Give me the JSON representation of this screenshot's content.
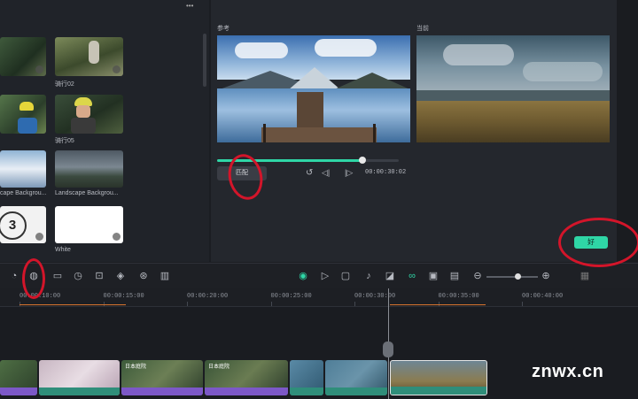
{
  "library": {
    "more_label": "•••",
    "items": [
      {
        "label": "骑行02"
      },
      {
        "label": "骑行05"
      },
      {
        "label": "Landscape Backgrou...",
        "partial_label": "cape Backgrou..."
      },
      {
        "label": "White"
      }
    ],
    "badge_number": "3"
  },
  "match": {
    "reference_label": "参考",
    "current_label": "当前",
    "match_button": "匹配",
    "timecode": "00:00:30:02",
    "progress": 0.8,
    "ok_button": "好"
  },
  "ruler": {
    "ticks": [
      "00:00:10:00",
      "00:00:15:00",
      "00:00:20:00",
      "00:00:25:00",
      "00:00:30:00",
      "00:00:35:00",
      "00:00:40:00"
    ]
  },
  "timeline": {
    "zoom_level": 0.6,
    "clips": [
      {
        "title": ""
      },
      {
        "title": ""
      },
      {
        "title": "日本庭院"
      },
      {
        "title": "日本庭院"
      },
      {
        "title": ""
      },
      {
        "title": ""
      },
      {
        "title": ""
      }
    ]
  },
  "watermark": "znwx.cn",
  "colors": {
    "accent": "#2fd6a6",
    "annotation": "#d3152a",
    "purple_strip": "#7c58c8",
    "teal_strip": "#2f8e7a"
  }
}
